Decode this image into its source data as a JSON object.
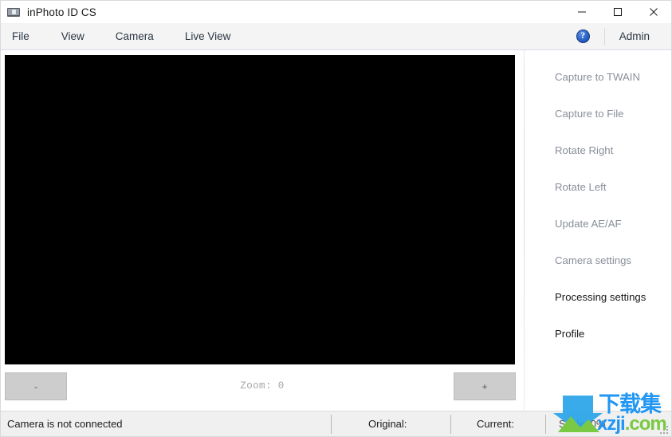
{
  "window": {
    "title": "inPhoto ID CS",
    "icon": "camera-icon",
    "controls": {
      "minimize": "minimize-icon",
      "maximize": "maximize-icon",
      "close": "close-icon"
    }
  },
  "menubar": {
    "items": [
      {
        "label": "File"
      },
      {
        "label": "View"
      },
      {
        "label": "Camera"
      },
      {
        "label": "Live View"
      }
    ],
    "help_icon": "help-question-icon",
    "help_glyph": "?",
    "user_label": "Admin"
  },
  "preview": {
    "background": "#000000",
    "content": ""
  },
  "zoom_controls": {
    "decrease_label": "-",
    "increase_label": "+",
    "status": "Zoom: 0",
    "value": 0
  },
  "sidebar": {
    "items": [
      {
        "label": "Capture to TWAIN",
        "enabled": false
      },
      {
        "label": "Capture to File",
        "enabled": false
      },
      {
        "label": "Rotate Right",
        "enabled": false
      },
      {
        "label": "Rotate Left",
        "enabled": false
      },
      {
        "label": "Update AE/AF",
        "enabled": false
      },
      {
        "label": "Camera settings",
        "enabled": false
      },
      {
        "label": "Processing settings",
        "enabled": true
      },
      {
        "label": "Profile",
        "enabled": true
      }
    ]
  },
  "statusbar": {
    "message": "Camera is not connected",
    "original_label": "Original:",
    "current_label": "Current:",
    "scale_label": "Scale: 0%"
  },
  "watermark": {
    "cn_text": "下载集",
    "domain_x": "xzji",
    "domain_rest": ".com"
  },
  "colors": {
    "accent_blue": "#2a63c8",
    "menu_text": "#2b3744",
    "disabled_text": "#898f99",
    "enabled_text": "#18191c",
    "button_face": "#cdcdcd",
    "statusbar_bg": "#f0f0f0",
    "menubar_bg": "#f4f4f4",
    "preview_bg": "#000000"
  }
}
